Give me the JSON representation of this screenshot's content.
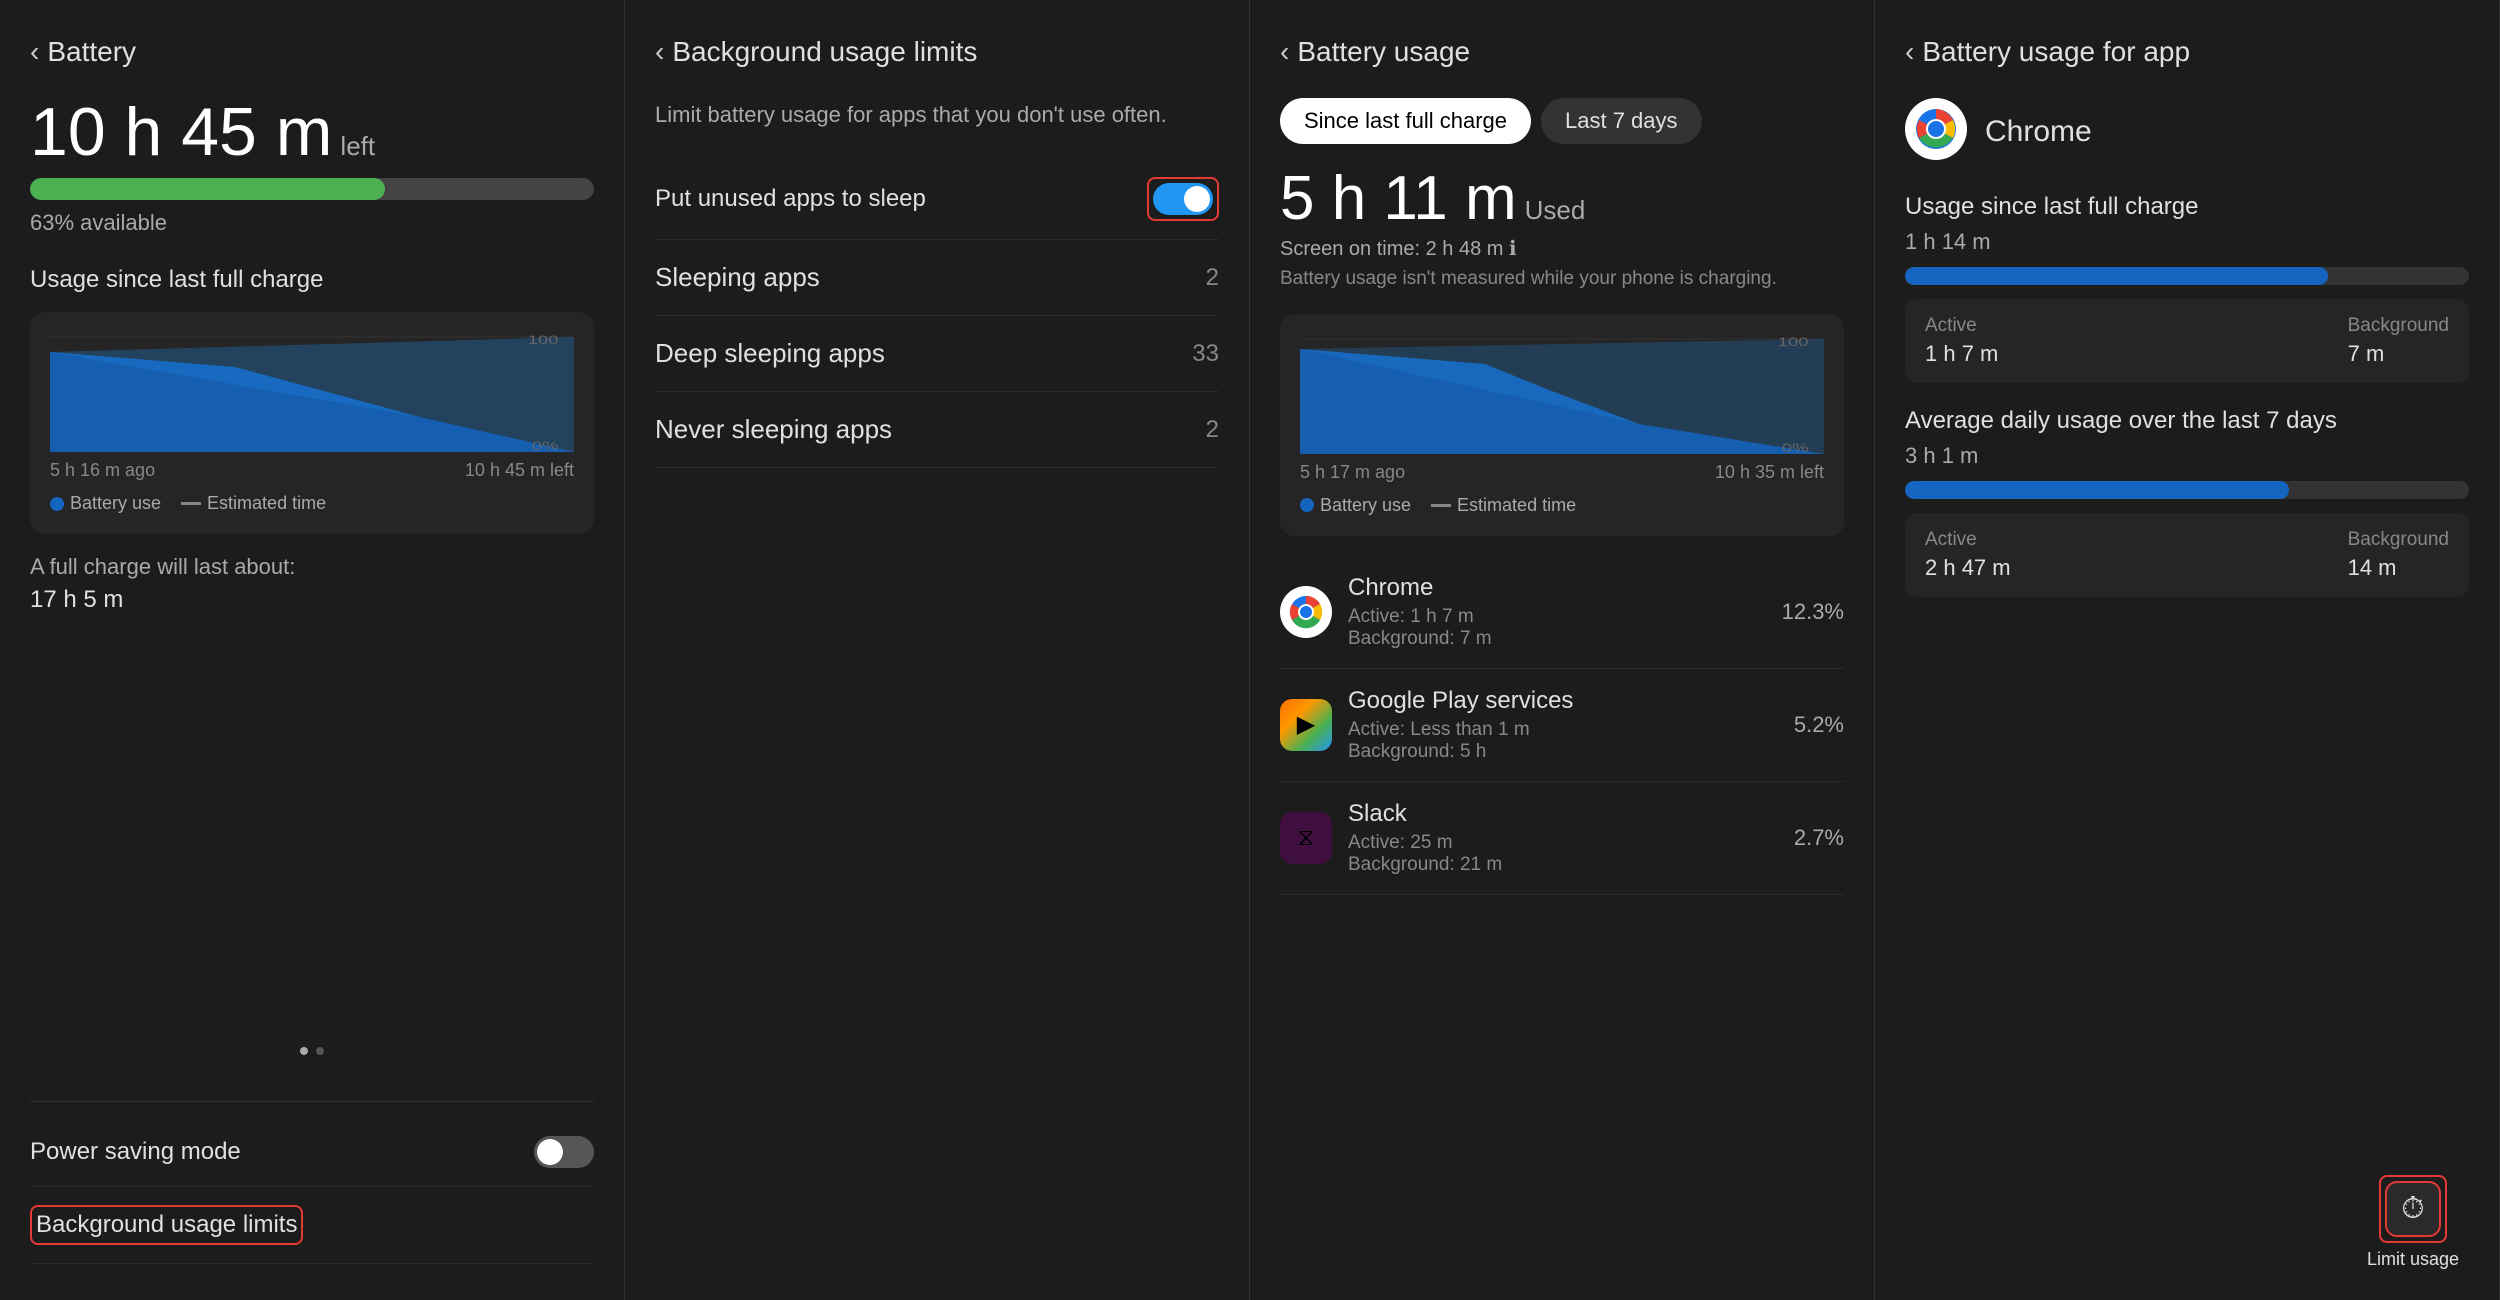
{
  "panel1": {
    "back_label": "Battery",
    "battery_hours": "10 h 45 m",
    "battery_left": "left",
    "battery_percent": 63,
    "percent_label": "63% available",
    "chart_section_title": "Usage since last full charge",
    "chart_left_label": "5 h 16 m ago",
    "chart_right_label": "10 h 45 m left",
    "chart_100_label": "100",
    "chart_0_label": "0%",
    "legend_battery": "Battery use",
    "legend_estimated": "Estimated time",
    "full_charge_label": "A full charge will last about:",
    "full_charge_time": "17 h 5 m",
    "setting_power_saving": "Power saving mode",
    "toggle_power_saving": false,
    "setting_background": "Background usage limits",
    "highlight_background": true
  },
  "panel2": {
    "back_label": "Background usage limits",
    "subtitle": "Limit battery usage for apps that you don't use often.",
    "put_unused_label": "Put unused apps to sleep",
    "toggle_put_unused": true,
    "highlight_toggle": true,
    "sleeping_apps_label": "Sleeping apps",
    "sleeping_apps_count": "2",
    "deep_sleeping_label": "Deep sleeping apps",
    "deep_sleeping_count": "33",
    "never_sleeping_label": "Never sleeping apps",
    "never_sleeping_count": "2"
  },
  "panel3": {
    "back_label": "Battery usage",
    "tab_since": "Since last full charge",
    "tab_7days": "Last 7 days",
    "used_time": "5 h 11 m",
    "used_label": "Used",
    "screen_on_time": "Screen on time: 2 h 48 m",
    "charging_warning": "Battery usage isn't measured while your phone is charging.",
    "chart_left_label": "5 h 17 m ago",
    "chart_right_label": "10 h 35 m left",
    "chart_100_label": "100",
    "chart_0_label": "0%",
    "legend_battery": "Battery use",
    "legend_estimated": "Estimated time",
    "apps": [
      {
        "name": "Chrome",
        "icon": "chrome",
        "detail1": "Active: 1 h 7 m",
        "detail2": "Background: 7 m",
        "percent": "12.3%"
      },
      {
        "name": "Google Play services",
        "icon": "gplay",
        "detail1": "Active: Less than 1 m",
        "detail2": "Background: 5 h",
        "percent": "5.2%"
      },
      {
        "name": "Slack",
        "icon": "slack",
        "detail1": "Active: 25 m",
        "detail2": "Background: 21 m",
        "percent": "2.7%"
      }
    ]
  },
  "panel4": {
    "back_label": "Battery usage for app",
    "app_name": "Chrome",
    "app_icon": "chrome",
    "usage_since_title": "Usage since last full charge",
    "usage_since_time": "1 h 14 m",
    "usage_since_bar": 75,
    "active_since_label": "Active",
    "active_since_value": "1 h 7 m",
    "background_since_label": "Background",
    "background_since_value": "7 m",
    "avg_title": "Average daily usage over the last 7 days",
    "avg_time": "3 h 1 m",
    "avg_bar": 68,
    "active_avg_label": "Active",
    "active_avg_value": "2 h 47 m",
    "background_avg_label": "Background",
    "background_avg_value": "14 m",
    "limit_usage_label": "Limit usage",
    "limit_icon": "⏱"
  }
}
